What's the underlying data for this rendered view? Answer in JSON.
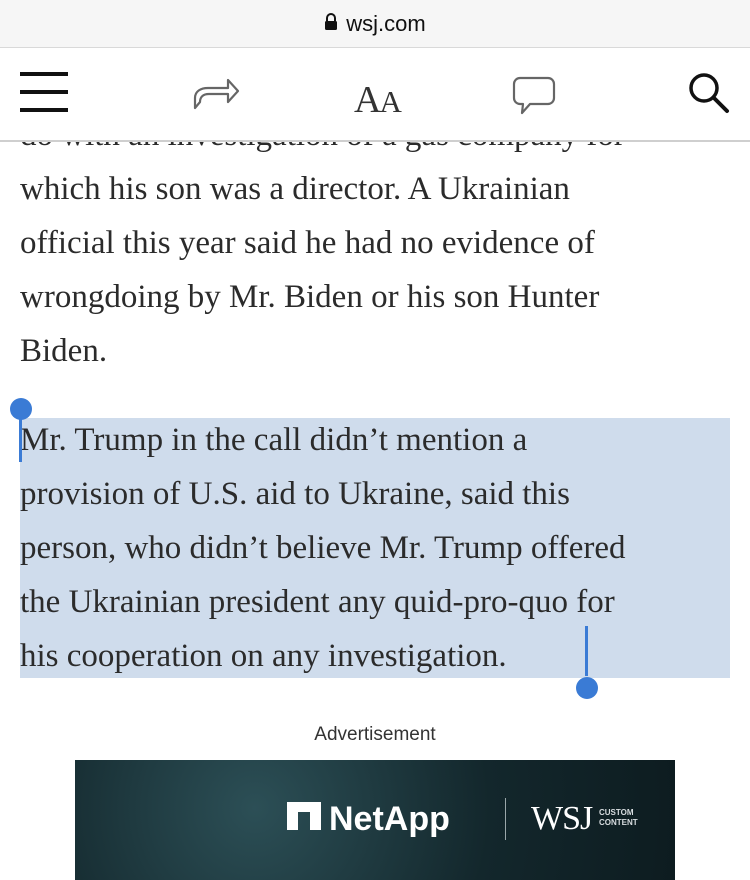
{
  "browser": {
    "url": "wsj.com"
  },
  "toolbar": {
    "font_size_big": "A",
    "font_size_small": "A"
  },
  "article": {
    "partial_line": "do with an investigation of a gas company for",
    "para1_lines": [
      "which his son was a director. A Ukrainian",
      "official this year said he had no evidence of",
      "wrongdoing by Mr. Biden or his son Hunter",
      "Biden."
    ],
    "para2_lines": [
      "Mr. Trump in the call didn’t mention a",
      "provision of U.S. aid to Ukraine, said this",
      "person, who didn’t believe Mr. Trump offered",
      "the Ukrainian president any quid-pro-quo for",
      "his cooperation on any investigation."
    ]
  },
  "ad": {
    "label": "Advertisement",
    "brand": "NetApp",
    "partner": "WSJ",
    "partner_tag_1": "CUSTOM",
    "partner_tag_2": "CONTENT"
  },
  "colors": {
    "selection": "#cfdcec",
    "selection_handle": "#3a7bd5",
    "ad_background": "#13272c"
  }
}
